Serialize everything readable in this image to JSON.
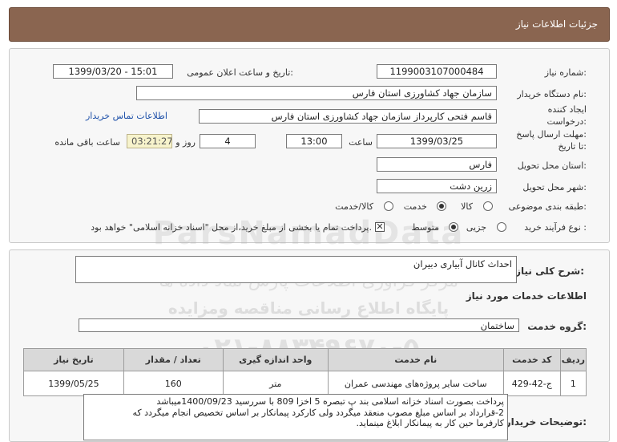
{
  "header": {
    "title": "جزئیات اطلاعات نیاز"
  },
  "fields": {
    "need_number_label": "شماره نیاز:",
    "need_number": "1199003107000484",
    "announce_label": "تاریخ و ساعت اعلان عمومی:",
    "announce_value": "1399/03/20 - 15:01",
    "buyer_label": "نام دستگاه خریدار:",
    "buyer_value": "سازمان جهاد کشاورزی استان فارس",
    "creator_label": "ایجاد کننده",
    "request_label": "درخواست:",
    "creator_value": "قاسم فتحی کارپرداز سازمان جهاد کشاورزی استان فارس",
    "contact_link": "اطلاعات تماس خریدار",
    "deadline_label1": "مهلت ارسال پاسخ:",
    "deadline_label2": "تا تاریخ:",
    "deadline_date": "1399/03/25",
    "time_label": "ساعت",
    "deadline_time": "13:00",
    "days_value": "4",
    "days_label": "روز و",
    "remaining_value": "03:21:27",
    "remaining_label": "ساعت باقی مانده",
    "province_label": "استان محل تحویل:",
    "province_value": "فارس",
    "city_label": "شهر محل تحویل:",
    "city_value": "زرین دشت",
    "category_label": "طبقه بندی موضوعی:",
    "category_options": [
      "کالا",
      "خدمت",
      "کالا/خدمت"
    ],
    "process_label": "نوع فرآیند خرید :",
    "process_options": [
      "جزیی",
      "متوسط"
    ],
    "payment_text": "پرداخت تمام یا بخشی از مبلغ خرید،از محل \"اسناد خزانه اسلامی\" خواهد بود."
  },
  "watermark": {
    "brand": "ParsNamadData",
    "line1": "مرکز فراوری اطلاعات پارس نماد داده ها",
    "line2": "پایگاه اطلاع رسانی مناقصه ومزایده",
    "phone": "۰۲۱-۸۸۳۴۹۶۷۰-۵"
  },
  "description": {
    "label": "شرح کلی نیاز:",
    "value": "احداث کانال آبیاری دبیران"
  },
  "services": {
    "section_title": "اطلاعات خدمات مورد نیاز",
    "group_label": "گروه خدمت:",
    "group_value": "ساختمان",
    "columns": [
      "ردیف",
      "کد خدمت",
      "نام خدمت",
      "واحد اندازه گیری",
      "تعداد / مقدار",
      "تاریخ نیاز"
    ],
    "rows": [
      [
        "1",
        "ج-42-429",
        "ساخت سایر پروژه‌های مهندسی عمران",
        "متر",
        "160",
        "1399/05/25"
      ]
    ]
  },
  "notes": {
    "label": "توضیحات خریدار:",
    "lines": [
      "پرداخت بصورت اسناد خزانه اسلامی بند پ تبصره 5  اخزا  809 با سررسید 1400/09/23میباشد",
      "2-قرارداد بر اساس مبلغ مصوب منعقد میگردد ولی کارکرد پیمانکار بر اساس تخصیص انجام  میگردد که",
      "کارفرما حین کار به پیمانکار ابلاغ مینماید."
    ]
  }
}
